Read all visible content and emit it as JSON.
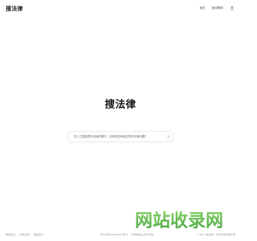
{
  "header": {
    "logo_text": "搜法律",
    "nav": {
      "home_label": "首页",
      "records_label": "使用帮助"
    },
    "user_icon": "user-icon"
  },
  "main": {
    "title": "搜法律",
    "search": {
      "placeholder": "在人工智能提问法律问题中，如何判定和适应所在法律问题？",
      "value": "",
      "send_icon": "send-arrow-icon"
    }
  },
  "footer": {
    "left_links": [
      "服务协议",
      "隐私条款",
      "网站统计"
    ],
    "center_text": [
      "京ICP备2024000000号-1",
      "增值电信业务许可证"
    ],
    "right_text": "© 2024 搜法律 | 北京科技有限公司"
  },
  "watermark": {
    "text": "网站收录网",
    "color": "#4caf50"
  }
}
